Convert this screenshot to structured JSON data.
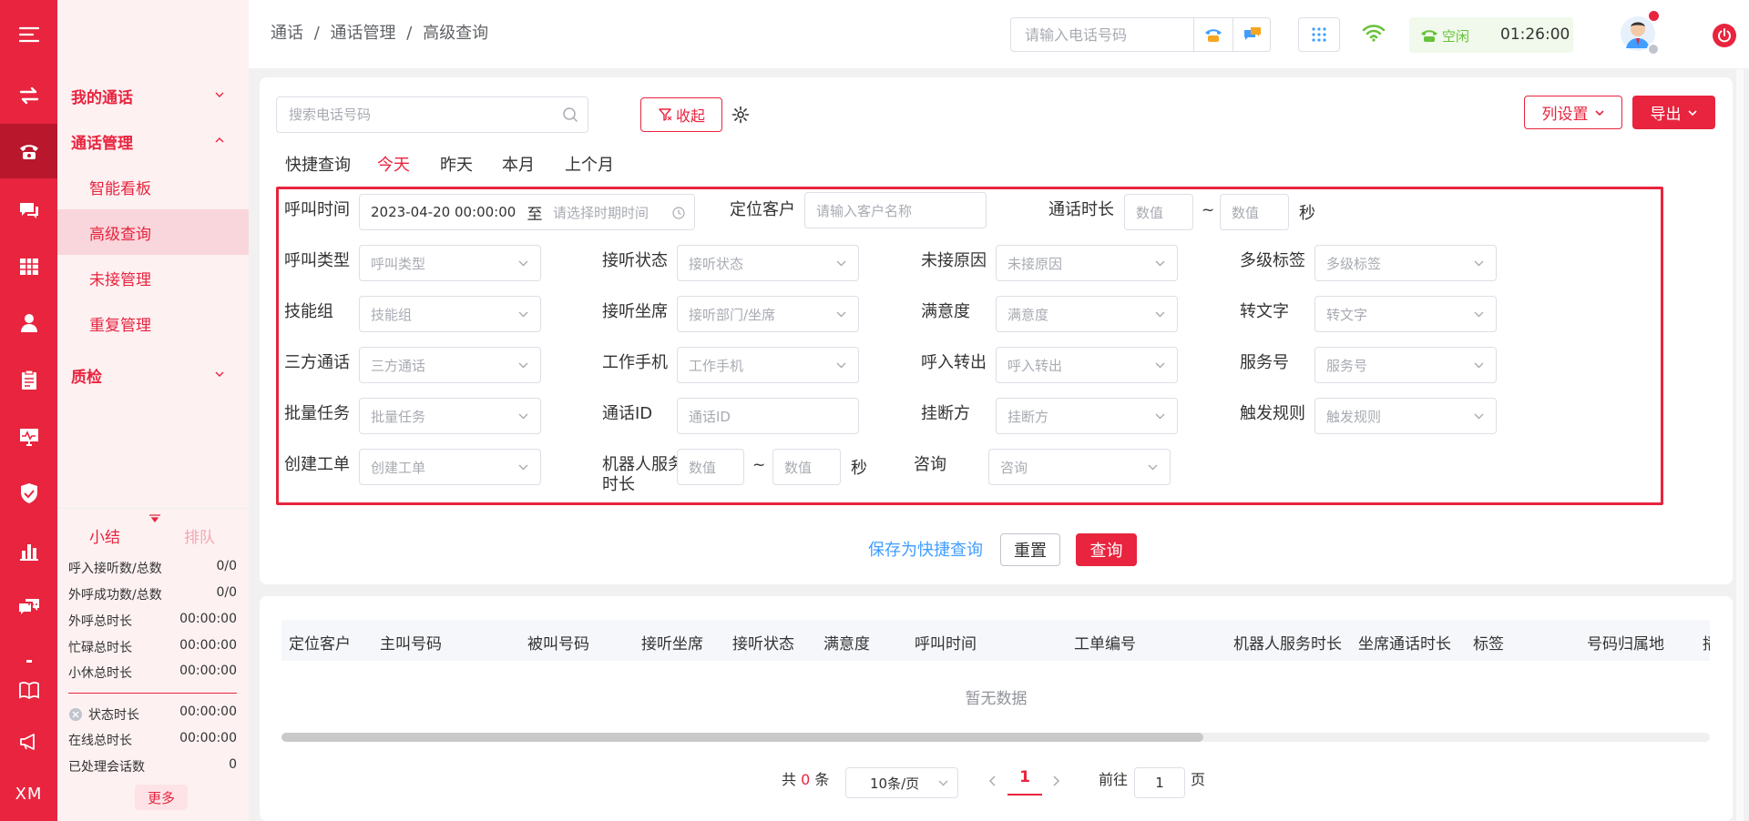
{
  "colors": {
    "brand": "#e8243e",
    "brand_dark": "#b8172c",
    "success": "#67c23a",
    "link": "#409eff"
  },
  "rail": {
    "icons": [
      "menu-icon",
      "transfer-icon",
      "phone-icon",
      "chat-icon",
      "table-icon",
      "user-icon",
      "clipboard-icon",
      "monitor-icon",
      "shield-icon",
      "bar-chart-icon",
      "message-icon",
      "dot-icon",
      "book-icon",
      "megaphone-icon"
    ],
    "xm": "XM"
  },
  "sidebar": {
    "groups": [
      {
        "label": "我的通话"
      },
      {
        "label": "通话管理"
      },
      {
        "label": "质检"
      }
    ],
    "items": [
      {
        "label": "智能看板"
      },
      {
        "label": "高级查询"
      },
      {
        "label": "未接管理"
      },
      {
        "label": "重复管理"
      }
    ]
  },
  "summary": {
    "tab_active": "小结",
    "tab_inactive": "排队",
    "rows": [
      {
        "label": "呼入接听数/总数",
        "value": "0/0"
      },
      {
        "label": "外呼成功数/总数",
        "value": "0/0"
      },
      {
        "label": "外呼总时长",
        "value": "00:00:00"
      },
      {
        "label": "忙碌总时长",
        "value": "00:00:00"
      },
      {
        "label": "小休总时长",
        "value": "00:00:00"
      },
      {
        "label": "状态时长",
        "value": "00:00:00"
      },
      {
        "label": "在线总时长",
        "value": "00:00:00"
      },
      {
        "label": "已处理会话数",
        "value": "0"
      }
    ],
    "more": "更多"
  },
  "header": {
    "breadcrumb": [
      "通话",
      "/",
      "通话管理",
      "/",
      "高级查询"
    ],
    "phone_placeholder": "请输入电话号码",
    "status": "空闲",
    "timer": "01:26:00"
  },
  "toolbar": {
    "search_placeholder": "搜索电话号码",
    "collapse": "收起",
    "column_settings": "列设置",
    "export": "导出"
  },
  "quick": {
    "label": "快捷查询",
    "items": [
      "今天",
      "昨天",
      "本月",
      "上个月"
    ]
  },
  "filters": {
    "call_time": "呼叫时间",
    "start": "2023-04-20 00:00:00",
    "to": "至",
    "end_placeholder": "请选择时期时间",
    "locate_customer": "定位客户",
    "customer_placeholder": "请输入客户名称",
    "duration": "通话时长",
    "num": "数值",
    "tilde": "~",
    "sec": "秒",
    "call_type": "呼叫类型",
    "answer_status": "接听状态",
    "missed_reason": "未接原因",
    "multi_tag": "多级标签",
    "skill_group": "技能组",
    "answer_seat": "接听坐席",
    "answer_seat_placeholder": "接听部门/坐席",
    "satisfaction": "满意度",
    "transcribe": "转文字",
    "three_way": "三方通话",
    "work_phone": "工作手机",
    "inbound_transfer": "呼入转出",
    "service_no": "服务号",
    "batch_task": "批量任务",
    "call_id": "通话ID",
    "hangup": "挂断方",
    "trigger_rule": "触发规则",
    "create_ticket": "创建工单",
    "robot_duration": "机器人服务时长",
    "consult": "咨询"
  },
  "actions": {
    "save": "保存为快捷查询",
    "reset": "重置",
    "query": "查询"
  },
  "table": {
    "columns": [
      "定位客户",
      "主叫号码",
      "被叫号码",
      "接听坐席",
      "接听状态",
      "满意度",
      "呼叫时间",
      "工单编号",
      "机器人服务时长",
      "坐席通话时长",
      "标签",
      "号码归属地",
      "播"
    ],
    "empty": "暂无数据"
  },
  "pagination": {
    "total_prefix": "共",
    "total": "0",
    "total_suffix": "条",
    "page_size": "10条/页",
    "current": "1",
    "goto_label": "前往",
    "goto_value": "1",
    "page_suffix": "页"
  }
}
